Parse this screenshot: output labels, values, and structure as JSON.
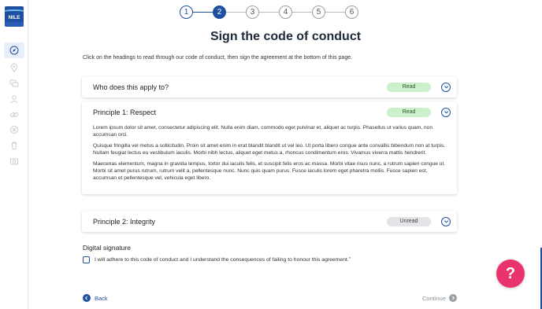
{
  "app": {
    "logo_text": "NILE"
  },
  "sidebar": {
    "items": [
      {
        "name": "compass",
        "active": true
      },
      {
        "name": "location-pin",
        "active": false
      },
      {
        "name": "chat",
        "active": false
      },
      {
        "name": "user",
        "active": false
      },
      {
        "name": "link",
        "active": false
      },
      {
        "name": "cancel",
        "active": false
      },
      {
        "name": "trash",
        "active": false
      },
      {
        "name": "camera",
        "active": false
      }
    ]
  },
  "stepper": {
    "steps": [
      "1",
      "2",
      "3",
      "4",
      "5",
      "6"
    ],
    "current": 2
  },
  "page": {
    "title": "Sign the code of conduct",
    "intro": "Click on the headings to read through our code of conduct, then sign the agreement at the bottom of this page."
  },
  "sections": [
    {
      "title": "Who does this apply to?",
      "status": "Read",
      "expanded": false
    },
    {
      "title": "Principle 1: Respect",
      "status": "Read",
      "expanded": true,
      "paragraphs": [
        "Lorem ipsum dolor sit amet, consectetur adipiscing elit. Nulla enim diam, commodo eget pulvinar et, aliquet ac turpis. Phasellus ut varius quam, non accumsan orci.",
        "Quisque fringilla vel metus a sollicitudin. Proin sit amet enim in erat blandit blandit ut vel leo. Ut porta libero congue ante convallis bibendum non at turpis. Nullam feugiat lectus eu vestibulum iaculis. Morbi nibh lectus, aliquet eget metus a, rhoncus condimentum eros. Vivamus viverra mattis hendrerit.",
        "Maecenas elementum, magna in gravida tempus, tortor dui iaculis felis, et suscipit felis eros ac massa. Morbi vitae risus nunc, a rutrum sapien congue ut. Morbi sit amet purus rutrum, rutrum velit a, pellentesque nunc. Nunc quis quam purus. Fusce iaculis lorem eget pharetra mollis. Fusce sapien est, accumsan et pellentesque vel, vehicula eget libero."
      ]
    },
    {
      "title": "Principle 2: Integrity",
      "status": "Unread",
      "expanded": false
    }
  ],
  "signature": {
    "title": "Digital signature",
    "label": "I will adhere to this code of conduct and I understand the consequences of failing to honour this agreement.",
    "required_mark": "*",
    "checked": false
  },
  "footer": {
    "back_label": "Back",
    "continue_label": "Continue"
  },
  "help": {
    "label": "?"
  },
  "colors": {
    "primary": "#1f4fa0",
    "read_bg": "#ccefcc",
    "unread_bg": "#e2e4e7",
    "help_bg": "#e8336d"
  }
}
